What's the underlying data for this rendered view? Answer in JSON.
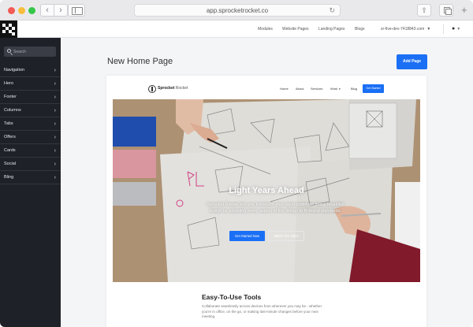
{
  "browser": {
    "url": "app.sprocketrocket.co",
    "nav_back_icon": "chevron-left-icon",
    "nav_forward_icon": "chevron-right-icon"
  },
  "appbar": {
    "menu": [
      "Modules",
      "Website Pages",
      "Landing Pages",
      "Blogs"
    ],
    "site_selector": "sr-five-dev-7418843.com",
    "user_icon": "user-icon"
  },
  "sidebar": {
    "search_placeholder": "Search",
    "items": [
      "Navigation",
      "Hero",
      "Footer",
      "Columns",
      "Tabs",
      "Offers",
      "Cards",
      "Social",
      "Bling"
    ]
  },
  "main": {
    "page_title": "New Home Page",
    "add_page_label": "Add Page"
  },
  "preview": {
    "brand_strong": "Sprocket",
    "brand_light": " Rocket",
    "nav": {
      "home": "Home",
      "about": "About",
      "services": "Services",
      "work": "Work",
      "blog": "Blog",
      "cta": "Get Started"
    },
    "hero": {
      "title": "Light Years Ahead",
      "text": "Sprocket Rocket lets you transform your rapid prototype into a beautiful design by adjusting every aspect of the design to fit brand standards.",
      "primary_button": "Get Started Now",
      "secondary_button": "Watch The Video"
    },
    "section": {
      "title": "Easy-To-Use Tools",
      "text": "Collaborate seamlessly across devices from wherever you may be - whether you're in office, on the go, or making last-minute changes before your next meeting."
    }
  },
  "colors": {
    "accent": "#1a6ff5",
    "sidebar_bg": "#1f2129"
  }
}
